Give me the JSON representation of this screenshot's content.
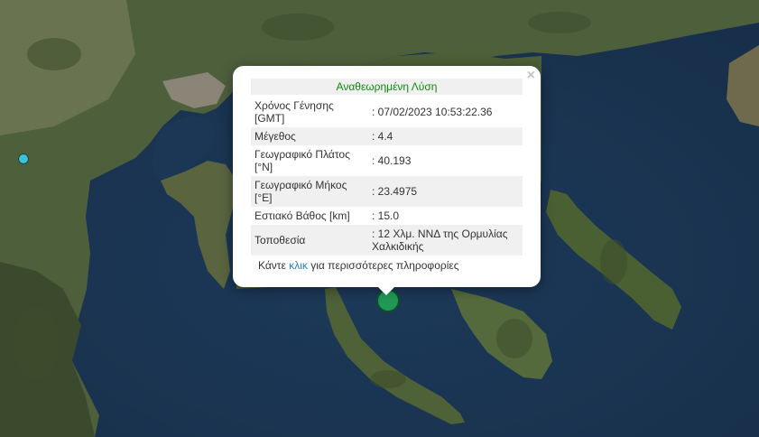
{
  "popup": {
    "title": "Αναθεωρημένη Λύση",
    "close_symbol": "×",
    "rows": [
      {
        "label": "Χρόνος Γένησης [GMT]",
        "value": ": 07/02/2023 10:53:22.36"
      },
      {
        "label": "Μέγεθος",
        "value": ": 4.4"
      },
      {
        "label": "Γεωγραφικό Πλάτος [°N]",
        "value": ": 40.193"
      },
      {
        "label": "Γεωγραφικό Μήκος [°E]",
        "value": ": 23.4975"
      },
      {
        "label": "Εστιακό Βάθος [km]",
        "value": ": 15.0"
      },
      {
        "label": "Τοποθεσία",
        "value": ": 12 Χλμ. ΝΝΔ της Ορμυλίας Χαλκιδικής"
      }
    ],
    "footer_prefix": "Κάντε ",
    "footer_link": "κλικ",
    "footer_suffix": " για περισσότερες πληροφορίες"
  },
  "colors": {
    "title_green": "#0c8a0c",
    "link_blue": "#2a7db5",
    "marker_main": "#1f9a55",
    "marker_small": "#3ec3cf"
  }
}
